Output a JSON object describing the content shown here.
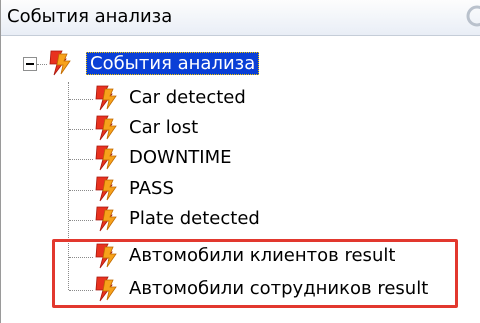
{
  "panel": {
    "title": "События анализа"
  },
  "tree": {
    "root": {
      "label": "События анализа",
      "icon": "lightning-bolt-icon",
      "expanded": true,
      "selected": true
    },
    "children": [
      {
        "label": "Car detected",
        "icon": "lightning-bolt-icon"
      },
      {
        "label": "Car lost",
        "icon": "lightning-bolt-icon"
      },
      {
        "label": "DOWNTIME",
        "icon": "lightning-bolt-icon"
      },
      {
        "label": "PASS",
        "icon": "lightning-bolt-icon"
      },
      {
        "label": "Plate detected",
        "icon": "lightning-bolt-icon"
      },
      {
        "label": "Автомобили клиентов result",
        "icon": "lightning-bolt-icon"
      },
      {
        "label": "Автомобили сотрудников result",
        "icon": "lightning-bolt-icon"
      }
    ]
  },
  "colors": {
    "selection": "#0a3fd6",
    "highlight_border": "#e2382e",
    "icon_red": "#e8321f",
    "icon_orange": "#f7a21b"
  }
}
